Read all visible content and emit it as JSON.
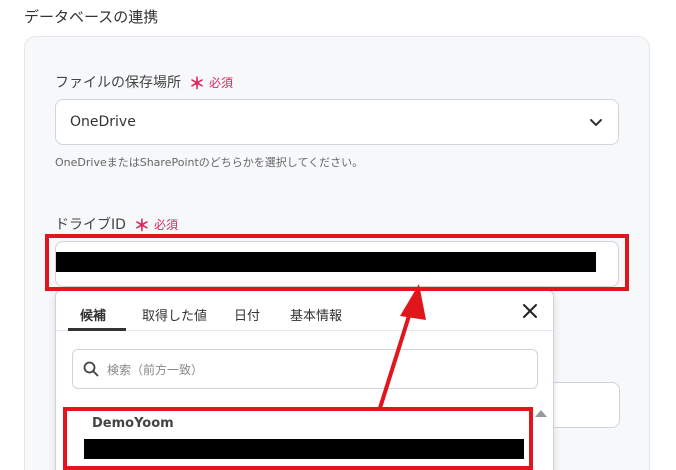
{
  "section_title": "データベースの連携",
  "storage": {
    "label": "ファイルの保存場所",
    "required_mark": "＊",
    "required_text": "必須",
    "value": "OneDrive",
    "help": "OneDriveまたはSharePointのどちらかを選択してください。"
  },
  "drive": {
    "label": "ドライブID",
    "required_mark": "＊",
    "required_text": "必須"
  },
  "dropdown": {
    "tabs": [
      {
        "label": "候補",
        "active": true
      },
      {
        "label": "取得した値",
        "active": false
      },
      {
        "label": "日付",
        "active": false
      },
      {
        "label": "基本情報",
        "active": false
      }
    ],
    "search_placeholder": "検索（前方一致）",
    "options": [
      {
        "name": "DemoYoom"
      }
    ]
  },
  "colors": {
    "required": "#e0245e",
    "highlight": "#e0161c",
    "card_bg": "#f7f8fa"
  }
}
